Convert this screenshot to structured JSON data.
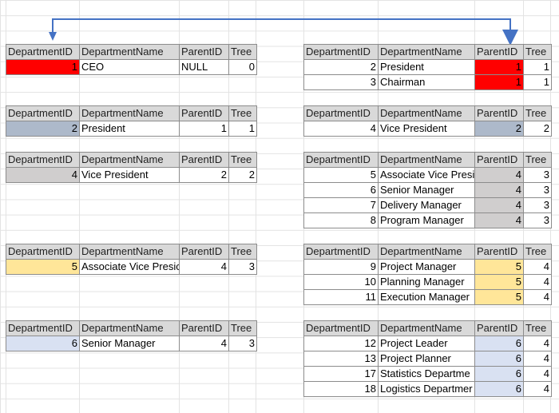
{
  "headers": [
    "DepartmentID",
    "DepartmentName",
    "ParentID",
    "Tree"
  ],
  "colors": {
    "red": "#ff0000",
    "blue_gray": "#adb9ca",
    "gray": "#d0cece",
    "yellow": "#ffe699",
    "light_blue": "#d9e1f2",
    "arrow": "#4472c4"
  },
  "left_tables": [
    {
      "rows": [
        {
          "id": "1",
          "name": "CEO",
          "parent": "NULL",
          "tree": "0",
          "id_color": "red"
        }
      ]
    },
    {
      "rows": [
        {
          "id": "2",
          "name": "President",
          "parent": "1",
          "tree": "1",
          "id_color": "blue_gray"
        }
      ]
    },
    {
      "rows": [
        {
          "id": "4",
          "name": "Vice President",
          "parent": "2",
          "tree": "2",
          "id_color": "gray"
        }
      ]
    },
    {
      "rows": [
        {
          "id": "5",
          "name": "Associate Vice Presic",
          "parent": "4",
          "tree": "3",
          "id_color": "yellow"
        }
      ]
    },
    {
      "rows": [
        {
          "id": "6",
          "name": "Senior Manager",
          "parent": "4",
          "tree": "3",
          "id_color": "light_blue"
        }
      ]
    }
  ],
  "right_tables": [
    {
      "rows": [
        {
          "id": "2",
          "name": "President",
          "parent": "1",
          "tree": "1",
          "parent_color": "red"
        },
        {
          "id": "3",
          "name": "Chairman",
          "parent": "1",
          "tree": "1",
          "parent_color": "red"
        }
      ]
    },
    {
      "rows": [
        {
          "id": "4",
          "name": "Vice President",
          "parent": "2",
          "tree": "2",
          "parent_color": "blue_gray"
        }
      ]
    },
    {
      "rows": [
        {
          "id": "5",
          "name": "Associate Vice Presi",
          "parent": "4",
          "tree": "3",
          "parent_color": "gray"
        },
        {
          "id": "6",
          "name": "Senior Manager",
          "parent": "4",
          "tree": "3",
          "parent_color": "gray"
        },
        {
          "id": "7",
          "name": "Delivery Manager",
          "parent": "4",
          "tree": "3",
          "parent_color": "gray"
        },
        {
          "id": "8",
          "name": "Program Manager",
          "parent": "4",
          "tree": "3",
          "parent_color": "gray"
        }
      ]
    },
    {
      "rows": [
        {
          "id": "9",
          "name": "Project Manager",
          "parent": "5",
          "tree": "4",
          "parent_color": "yellow"
        },
        {
          "id": "10",
          "name": "Planning Manager",
          "parent": "5",
          "tree": "4",
          "parent_color": "yellow"
        },
        {
          "id": "11",
          "name": "Execution Manager",
          "parent": "5",
          "tree": "4",
          "parent_color": "yellow"
        }
      ]
    },
    {
      "rows": [
        {
          "id": "12",
          "name": "Project Leader",
          "parent": "6",
          "tree": "4",
          "parent_color": "light_blue"
        },
        {
          "id": "13",
          "name": "Project Planner",
          "parent": "6",
          "tree": "4",
          "parent_color": "light_blue"
        },
        {
          "id": "17",
          "name": "Statistics Departme",
          "parent": "6",
          "tree": "4",
          "parent_color": "light_blue"
        },
        {
          "id": "18",
          "name": "Logistics Departmer",
          "parent": "6",
          "tree": "4",
          "parent_color": "light_blue"
        }
      ]
    }
  ]
}
